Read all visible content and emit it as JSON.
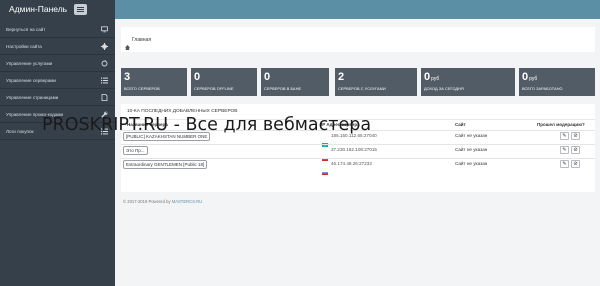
{
  "header": {
    "brand": "Админ-Панель",
    "menu_icon": "hamburger-icon"
  },
  "sidebar": {
    "items": [
      {
        "label": "Вернуться на сайт",
        "icon": "monitor-icon"
      },
      {
        "label": "Настройки сайта",
        "icon": "gear-icon"
      },
      {
        "label": "Управление услугами",
        "icon": "refresh-icon"
      },
      {
        "label": "Управление серверами",
        "icon": "list-icon"
      },
      {
        "label": "Управление страницами",
        "icon": "document-icon"
      },
      {
        "label": "Управление промо-кодами",
        "icon": "wrench-icon"
      },
      {
        "label": "Логи покупок",
        "icon": "list-icon"
      }
    ]
  },
  "breadcrumb": {
    "home": "Главная"
  },
  "stats": [
    {
      "value": "3",
      "unit": "",
      "label": "ВСЕГО СЕРВЕРОВ"
    },
    {
      "value": "0",
      "unit": "",
      "label": "СЕРВЕРОВ OFFLINE"
    },
    {
      "value": "0",
      "unit": "",
      "label": "СЕРВЕРОВ В БАНЕ"
    },
    {
      "value": "2",
      "unit": "",
      "label": "СЕРВЕРОВ С УСЛУГАМИ"
    },
    {
      "value": "0",
      "unit": "руб",
      "label": "ДОХОД ЗА СЕГОДНЯ"
    },
    {
      "value": "0",
      "unit": "руб",
      "label": "ВСЕГО ЗАРАБОТАНО"
    }
  ],
  "servers_panel": {
    "title": "10-КА ПОСЛЕДНИХ ДОБАВЛЕННЫХ СЕРВЕРОВ",
    "columns": [
      "Название сервера",
      "IP Адрес сервера",
      "Сайт",
      "Прошел модерацию?"
    ],
    "rows": [
      {
        "name": "[PUBLIC] KAZAKHSTAN NUMBER ONE",
        "ip": "185.150.112.65:27040",
        "site": "Сайт не указан",
        "flag": "kz"
      },
      {
        "name": "Это Пр...",
        "ip": "37.230.162.108:27015",
        "site": "Сайт не указан",
        "flag": "ru"
      },
      {
        "name": "Extraordinary GENTLEMEN [Public 18]",
        "ip": "46.174.48.26:27232",
        "site": "Сайт не указан",
        "flag": "ru"
      }
    ],
    "actions": [
      "edit-icon",
      "ban-icon"
    ]
  },
  "footer": {
    "text": "© 2017-2019 Powered by ",
    "link": "MASTERCS.RU"
  },
  "watermark": "PROSKRIPT.RU - Все для вебмастера",
  "colors": {
    "topbar": "#5a8fa6",
    "sidebar": "#35404b",
    "stat_box": "#525c66"
  }
}
